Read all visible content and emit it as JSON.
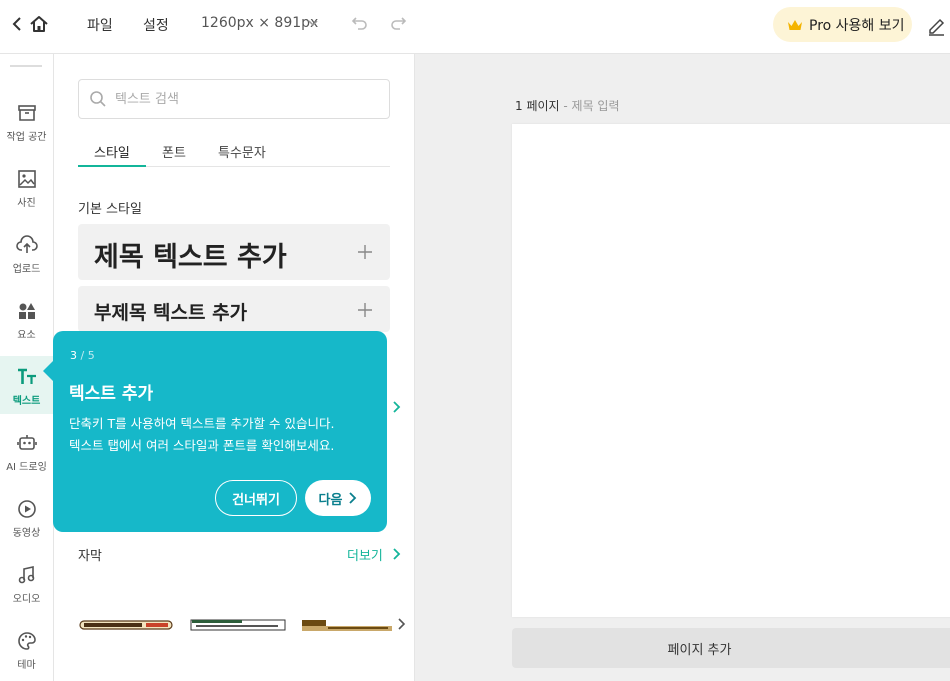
{
  "topbar": {
    "menu_file": "파일",
    "menu_settings": "설정",
    "canvas_size": "1260px × 891px",
    "pro_label": "Pro 사용해 보기"
  },
  "rail": {
    "items": [
      {
        "label": "작업 공간",
        "icon": "archive-icon"
      },
      {
        "label": "사진",
        "icon": "image-icon"
      },
      {
        "label": "업로드",
        "icon": "cloud-upload-icon"
      },
      {
        "label": "요소",
        "icon": "shapes-icon"
      },
      {
        "label": "텍스트",
        "icon": "text-tt-icon",
        "active": true
      },
      {
        "label": "AI 드로잉",
        "icon": "robot-icon"
      },
      {
        "label": "동영상",
        "icon": "play-circle-icon"
      },
      {
        "label": "오디오",
        "icon": "music-note-icon"
      },
      {
        "label": "테마",
        "icon": "palette-icon"
      }
    ]
  },
  "panel": {
    "search_placeholder": "텍스트 검색",
    "tabs": [
      "스타일",
      "폰트",
      "특수문자"
    ],
    "basic_style_title": "기본 스타일",
    "heading_card": "제목 텍스트 추가",
    "subheading_card": "부제목 텍스트 추가",
    "subtitle_section": "자막",
    "more_label": "더보기"
  },
  "workspace": {
    "page_number": "1 페이지",
    "page_title_placeholder": " - 제목 입력",
    "add_page": "페이지 추가"
  },
  "tooltip": {
    "step": "3",
    "total": " / 5",
    "title": "텍스트 추가",
    "line1": "단축키 T를 사용하여 텍스트를 추가할 수 있습니다.",
    "line2": "텍스트 탭에서 여러 스타일과 폰트를 확인해보세요.",
    "skip": "건너뛰기",
    "next": "다음"
  },
  "colors": {
    "accent": "#13b59a",
    "tooltip_bg": "#16b8c9",
    "pro_bg": "#fdf4d6"
  }
}
